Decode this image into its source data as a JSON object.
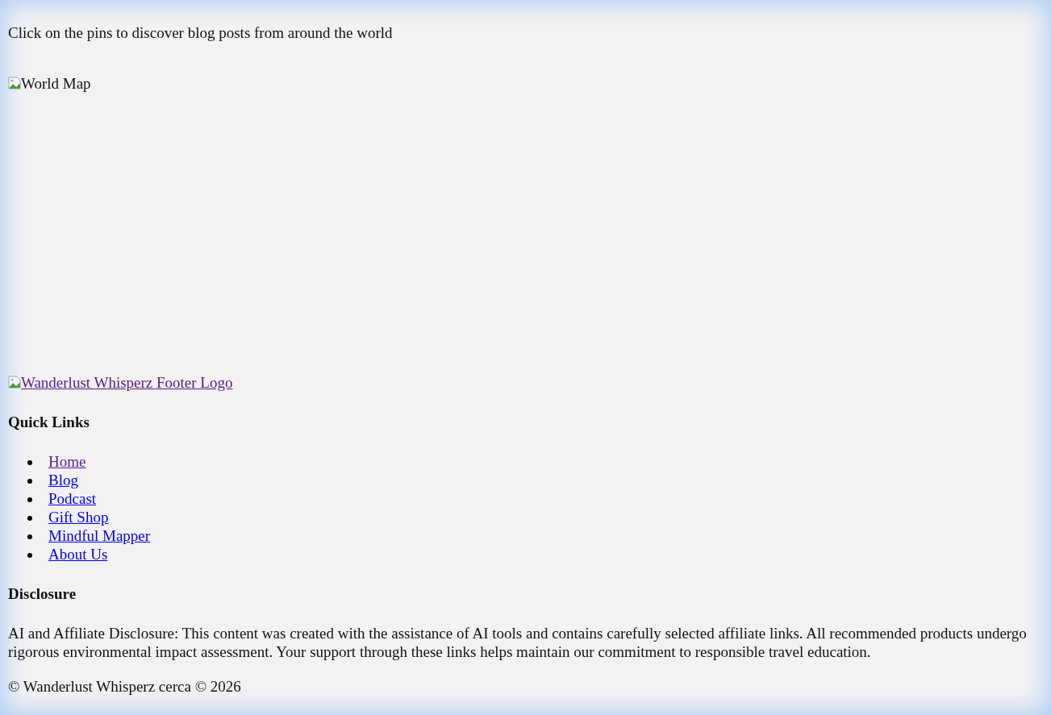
{
  "intro": "Click on the pins to discover blog posts from around the world",
  "map": {
    "alt": "World Map"
  },
  "footer": {
    "logo_alt": "Wanderlust Whisperz Footer Logo",
    "logo_visited": true,
    "quick_links": {
      "heading": "Quick Links",
      "items": [
        {
          "label": "Home",
          "visited": true
        },
        {
          "label": "Blog",
          "visited": false
        },
        {
          "label": "Podcast",
          "visited": false
        },
        {
          "label": "Gift Shop",
          "visited": false
        },
        {
          "label": "Mindful Mapper",
          "visited": false
        },
        {
          "label": "About Us",
          "visited": false
        }
      ]
    },
    "disclosure": {
      "heading": "Disclosure",
      "text": "AI and Affiliate Disclosure: This content was created with the assistance of AI tools and contains carefully selected affiliate links. All recommended products undergo rigorous environmental impact assessment. Your support through these links helps maintain our commitment to responsible travel education."
    },
    "copyright": "© Wanderlust Whisperz cerca © 2026"
  }
}
